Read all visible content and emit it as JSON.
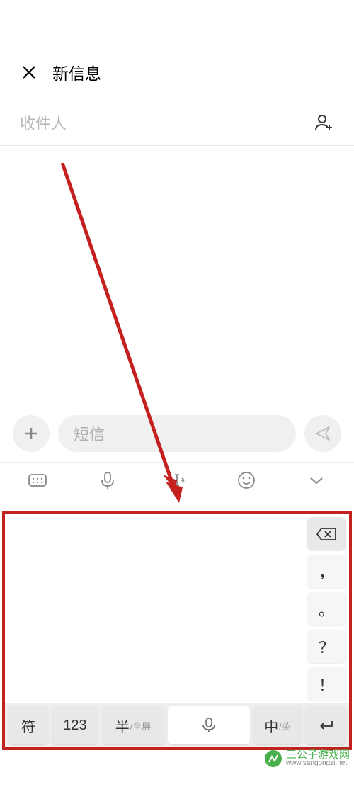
{
  "header": {
    "title": "新信息"
  },
  "recipient": {
    "placeholder": "收件人"
  },
  "compose": {
    "placeholder": "短信"
  },
  "keyboard": {
    "side": {
      "comma": "，",
      "period": "。",
      "question": "？",
      "exclaim": "！"
    },
    "bottom": {
      "symbol": "符",
      "number": "123",
      "half_main": "半",
      "half_sub": "/全屏",
      "lang_main": "中",
      "lang_sub": "/英"
    }
  },
  "watermark": {
    "text": "三公子游戏网",
    "url": "www.sangongzi.net"
  }
}
